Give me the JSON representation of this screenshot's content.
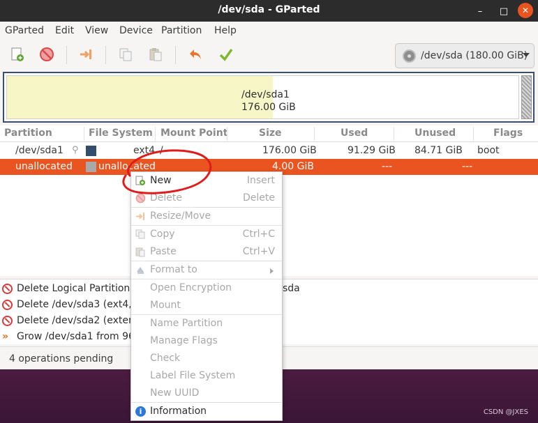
{
  "window": {
    "title": "/dev/sda - GParted"
  },
  "menubar": {
    "items": [
      "GParted",
      "Edit",
      "View",
      "Device",
      "Partition",
      "Help"
    ]
  },
  "toolbar": {
    "buttons": [
      "new-icon",
      "delete-icon",
      "resize-move-icon",
      "copy-icon",
      "paste-icon",
      "undo-icon",
      "apply-icon"
    ],
    "device_selector": "/dev/sda (180.00 GiB)"
  },
  "disk_graphic": {
    "partition_name": "/dev/sda1",
    "partition_size": "176.00 GiB",
    "used_fraction": 0.52
  },
  "partition_table": {
    "columns": [
      "Partition",
      "File System",
      "Mount Point",
      "Size",
      "Used",
      "Unused",
      "Flags"
    ],
    "rows": [
      {
        "partition": "/dev/sda1",
        "filesystem": "ext4",
        "mount_point": "/",
        "size": "176.00 GiB",
        "used": "91.29 GiB",
        "unused": "84.71 GiB",
        "flags": "boot",
        "fs_color": "#314e6c"
      },
      {
        "partition": "unallocated",
        "filesystem": "unallocated",
        "mount_point": "",
        "size": "4.00 GiB",
        "used": "---",
        "unused": "---",
        "flags": "",
        "fs_color": "#a9a9a9"
      }
    ]
  },
  "operations": {
    "items": [
      {
        "icon": "delete-icon",
        "text": "Delete Logical Partition ("
      },
      {
        "icon": "delete-icon",
        "text": "Delete /dev/sda3 (ext4, 8"
      },
      {
        "icon": "delete-icon",
        "text": "Delete /dev/sda2 (extend"
      },
      {
        "icon": "resize-icon",
        "text": "Grow /dev/sda1 from 96."
      }
    ],
    "overflow_text": "sda"
  },
  "status": {
    "text": "4 operations pending"
  },
  "context_menu": {
    "items": [
      {
        "label": "New",
        "accel": "Insert",
        "enabled": true,
        "icon": "new-icon"
      },
      {
        "label": "Delete",
        "accel": "Delete",
        "enabled": false,
        "icon": "delete-icon"
      },
      {
        "label": "Resize/Move",
        "accel": "",
        "enabled": false,
        "icon": "resize-move-icon"
      },
      {
        "label": "Copy",
        "accel": "Ctrl+C",
        "enabled": false,
        "icon": "copy-icon"
      },
      {
        "label": "Paste",
        "accel": "Ctrl+V",
        "enabled": false,
        "icon": "paste-icon"
      },
      {
        "label": "Format to",
        "accel": "",
        "enabled": false,
        "icon": "format-icon"
      },
      {
        "label": "Open Encryption",
        "accel": "",
        "enabled": false
      },
      {
        "label": "Mount",
        "accel": "",
        "enabled": false
      },
      {
        "label": "Name Partition",
        "accel": "",
        "enabled": false
      },
      {
        "label": "Manage Flags",
        "accel": "",
        "enabled": false
      },
      {
        "label": "Check",
        "accel": "",
        "enabled": false
      },
      {
        "label": "Label File System",
        "accel": "",
        "enabled": false
      },
      {
        "label": "New UUID",
        "accel": "",
        "enabled": false
      },
      {
        "label": "Information",
        "accel": "",
        "enabled": true,
        "icon": "info-icon"
      }
    ]
  },
  "watermark": "CSDN @JXES",
  "colors": {
    "selection": "#e95420",
    "annotation": "#e01b1b",
    "titlebar": "#2c2c2c",
    "used_fill": "#f6f6c7"
  }
}
